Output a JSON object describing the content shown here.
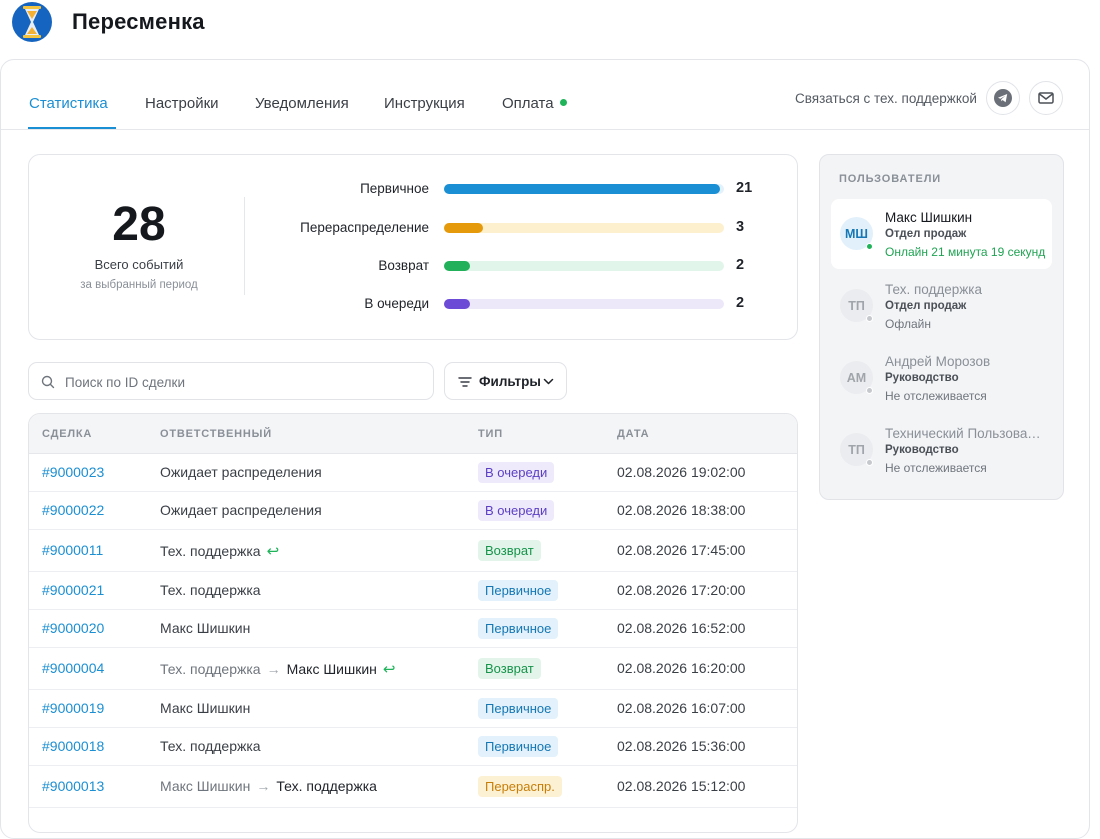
{
  "app": {
    "title": "Пересменка"
  },
  "tabs": [
    {
      "label": "Статистика",
      "active": true
    },
    {
      "label": "Настройки",
      "active": false
    },
    {
      "label": "Уведомления",
      "active": false
    },
    {
      "label": "Инструкция",
      "active": false
    },
    {
      "label": "Оплата",
      "active": false,
      "status_dot": "green"
    }
  ],
  "support": {
    "label": "Связаться с тех. поддержкой",
    "icons": [
      "telegram-icon",
      "mail-icon"
    ]
  },
  "stats": {
    "total": "28",
    "total_label": "Всего событий",
    "total_sub": "за выбранный период",
    "rows": [
      {
        "label": "Первичное",
        "value": "21",
        "fraction": 1.0,
        "color": "#1b8fd3",
        "track": "#e3f1fb"
      },
      {
        "label": "Перераспределение",
        "value": "3",
        "fraction": 0.143,
        "color": "#e59a0c",
        "track": "#fdf0cf"
      },
      {
        "label": "Возврат",
        "value": "2",
        "fraction": 0.095,
        "color": "#22b05b",
        "track": "#e2f5ea"
      },
      {
        "label": "В очереди",
        "value": "2",
        "fraction": 0.095,
        "color": "#6c4bd6",
        "track": "#ece8fa"
      }
    ]
  },
  "search": {
    "placeholder": "Поиск по ID сделки",
    "value": ""
  },
  "filters": {
    "label": "Фильтры"
  },
  "table": {
    "headers": {
      "deal": "СДЕЛКА",
      "responsible": "ОТВЕТСТВЕННЫЙ",
      "type": "ТИП",
      "date": "ДАТА"
    },
    "rows": [
      {
        "deal": "#9000023",
        "from": "",
        "to": "Ожидает распределения",
        "return": false,
        "type": "В очереди",
        "type_kind": "queue",
        "date": "02.08.2026 19:02:00"
      },
      {
        "deal": "#9000022",
        "from": "",
        "to": "Ожидает распределения",
        "return": false,
        "type": "В очереди",
        "type_kind": "queue",
        "date": "02.08.2026 18:38:00"
      },
      {
        "deal": "#9000011",
        "from": "",
        "to": "Тех. поддержка",
        "return": true,
        "type": "Возврат",
        "type_kind": "return",
        "date": "02.08.2026 17:45:00"
      },
      {
        "deal": "#9000021",
        "from": "",
        "to": "Тех. поддержка",
        "return": false,
        "type": "Первичное",
        "type_kind": "primary",
        "date": "02.08.2026 17:20:00"
      },
      {
        "deal": "#9000020",
        "from": "",
        "to": "Макс Шишкин",
        "return": false,
        "type": "Первичное",
        "type_kind": "primary",
        "date": "02.08.2026 16:52:00"
      },
      {
        "deal": "#9000004",
        "from": "Тех. поддержка",
        "to": "Макс Шишкин",
        "return": true,
        "type": "Возврат",
        "type_kind": "return",
        "date": "02.08.2026 16:20:00"
      },
      {
        "deal": "#9000019",
        "from": "",
        "to": "Макс Шишкин",
        "return": false,
        "type": "Первичное",
        "type_kind": "primary",
        "date": "02.08.2026 16:07:00"
      },
      {
        "deal": "#9000018",
        "from": "",
        "to": "Тех. поддержка",
        "return": false,
        "type": "Первичное",
        "type_kind": "primary",
        "date": "02.08.2026 15:36:00"
      },
      {
        "deal": "#9000013",
        "from": "Макс Шишкин",
        "to": "Тех. поддержка",
        "return": false,
        "type": "Перераспр.",
        "type_kind": "redistribution",
        "date": "02.08.2026 15:12:00"
      }
    ]
  },
  "badge_colors": {
    "queue": {
      "bg": "#eeeafb",
      "fg": "#5b3fc4"
    },
    "return": {
      "bg": "#e3f5ea",
      "fg": "#16934a"
    },
    "primary": {
      "bg": "#e2f1fb",
      "fg": "#1577b4"
    },
    "redistribution": {
      "bg": "#fdf1d4",
      "fg": "#c77e07"
    }
  },
  "users": {
    "title": "ПОЛЬЗОВАТЕЛИ",
    "items": [
      {
        "initials": "МШ",
        "name": "Макс Шишкин",
        "dept": "Отдел продаж",
        "status": "Онлайн 21 минута 19 секунд",
        "online": true
      },
      {
        "initials": "ТП",
        "name": "Тех. поддержка",
        "dept": "Отдел продаж",
        "status": "Офлайн",
        "online": false
      },
      {
        "initials": "АМ",
        "name": "Андрей Морозов",
        "dept": "Руководство",
        "status": "Не отслеживается",
        "online": false
      },
      {
        "initials": "ТП",
        "name": "Технический Пользователь",
        "dept": "Руководство",
        "status": "Не отслеживается",
        "online": false
      }
    ]
  }
}
